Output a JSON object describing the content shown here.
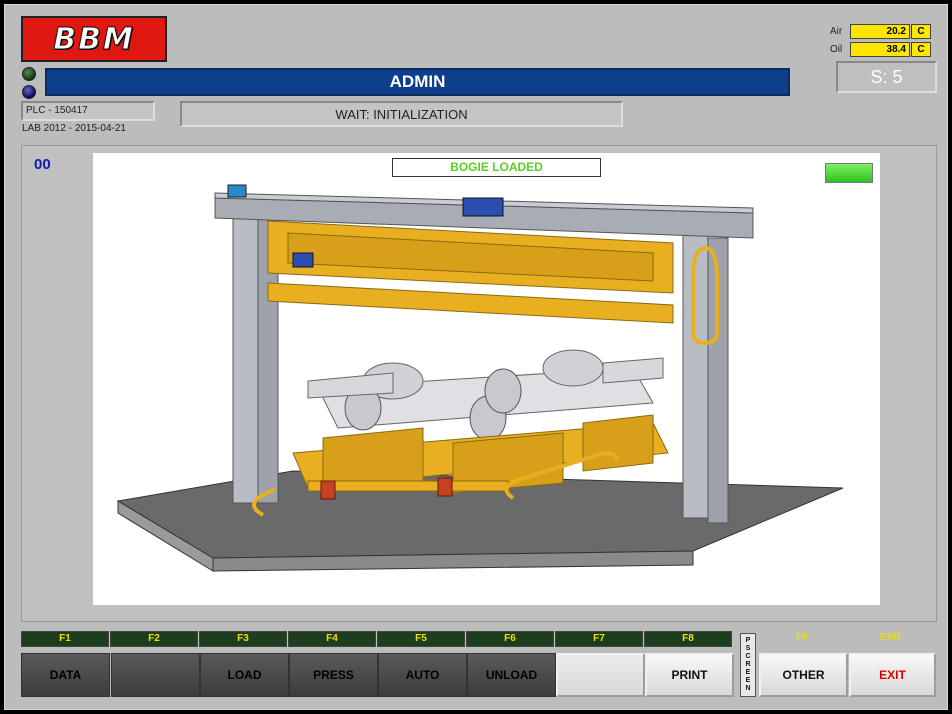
{
  "header": {
    "logo_text": "BBM",
    "user": "ADMIN",
    "plc": "PLC - 150417",
    "lab_date": "LAB 2012 - 2015-04-21",
    "status": "WAIT: INITIALIZATION",
    "step": "S: 5"
  },
  "temperatures": {
    "air": {
      "label": "Air",
      "value": "20.2",
      "unit": "C"
    },
    "oil": {
      "label": "Oil",
      "value": "38.4",
      "unit": "C"
    }
  },
  "panel": {
    "code": "00",
    "bogie_status": "BOGIE LOADED"
  },
  "function_keys": {
    "f1": "F1",
    "f2": "F2",
    "f3": "F3",
    "f4": "F4",
    "f5": "F5",
    "f6": "F6",
    "f7": "F7",
    "f8": "F8",
    "f9": "F9",
    "exit": "EXIT"
  },
  "buttons": {
    "data": "DATA",
    "f2": "",
    "load": "LOAD",
    "press": "PRESS",
    "auto": "AUTO",
    "unload": "UNLOAD",
    "f7": "",
    "print": "PRINT",
    "other": "OTHER",
    "exit": "EXIT"
  },
  "pscreen": [
    "P",
    "S",
    "C",
    "R",
    "E",
    "E",
    "N"
  ],
  "colors": {
    "accent_blue": "#0e3f8c",
    "logo_red": "#e11712",
    "temp_yellow": "#ffe600",
    "status_green": "#5ad020",
    "exit_red": "#e00000"
  }
}
